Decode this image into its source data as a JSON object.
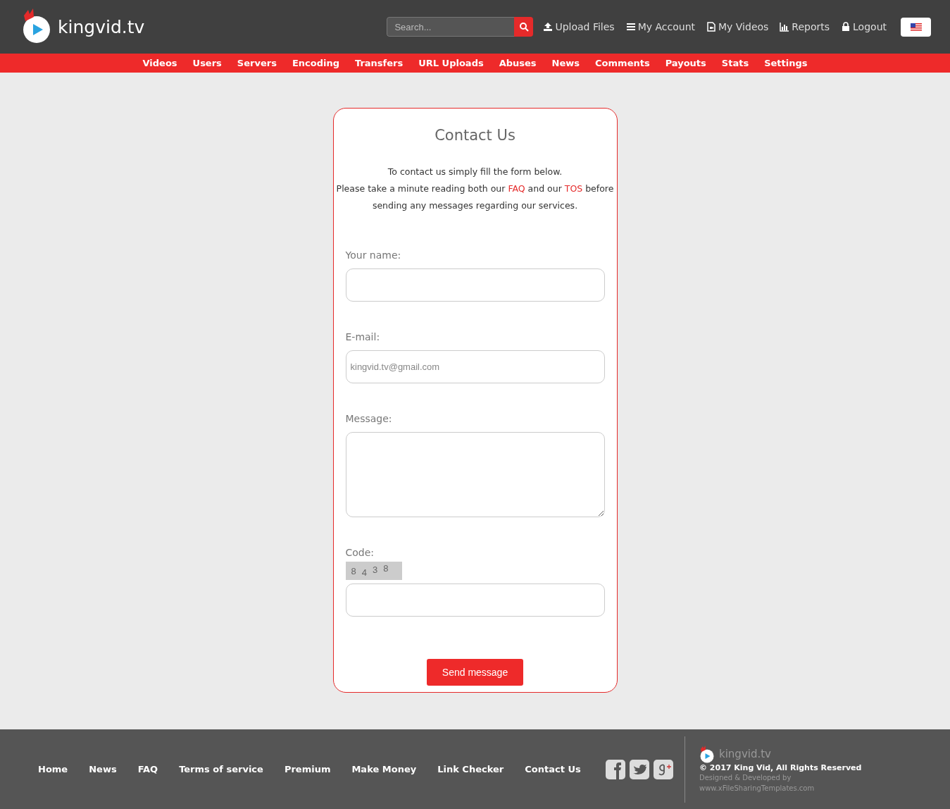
{
  "header": {
    "logo_text": "kingvid.tv",
    "search": {
      "placeholder": "Search..."
    },
    "links": [
      {
        "kind": "upload",
        "label": "Upload Files"
      },
      {
        "kind": "account",
        "label": "My Account"
      },
      {
        "kind": "videos",
        "label": "My Videos"
      },
      {
        "kind": "reports",
        "label": "Reports"
      },
      {
        "kind": "lock",
        "label": "Logout"
      }
    ]
  },
  "nav": [
    "Videos",
    "Users",
    "Servers",
    "Encoding",
    "Transfers",
    "URL Uploads",
    "Abuses",
    "News",
    "Comments",
    "Payouts",
    "Stats",
    "Settings"
  ],
  "form": {
    "title": "Contact Us",
    "intro": "To contact us simply fill the form below.",
    "notice": [
      {
        "kind": "text",
        "text": "Please take a minute reading both our "
      },
      {
        "kind": "link",
        "text": "FAQ"
      },
      {
        "kind": "text",
        "text": " and our "
      },
      {
        "kind": "link",
        "text": "TOS"
      },
      {
        "kind": "text",
        "text": " before sending any messages regarding our services."
      }
    ],
    "fields": [
      {
        "kind": "input",
        "label": "Your name:"
      },
      {
        "kind": "input",
        "label": "E-mail:",
        "value": "kingvid.tv@gmail.com"
      },
      {
        "kind": "textarea",
        "label": "Message:"
      },
      {
        "kind": "captcha",
        "label": "Code:",
        "code": [
          "8",
          "4",
          "3",
          "8"
        ]
      }
    ],
    "button": "Send message"
  },
  "footer": {
    "links": [
      "Home",
      "News",
      "FAQ",
      "Terms of service",
      "Premium",
      "Make Money",
      "Link Checker",
      "Contact Us"
    ],
    "social": [
      {
        "kind": "facebook"
      },
      {
        "kind": "twitter"
      },
      {
        "kind": "google-plus"
      }
    ],
    "logo_text": "kingvid.tv",
    "copyright": "© 2017 King Vid, All Rights Reserved",
    "credit": [
      "Designed & Developed by",
      "www.xFileSharingTemplates.com"
    ]
  }
}
